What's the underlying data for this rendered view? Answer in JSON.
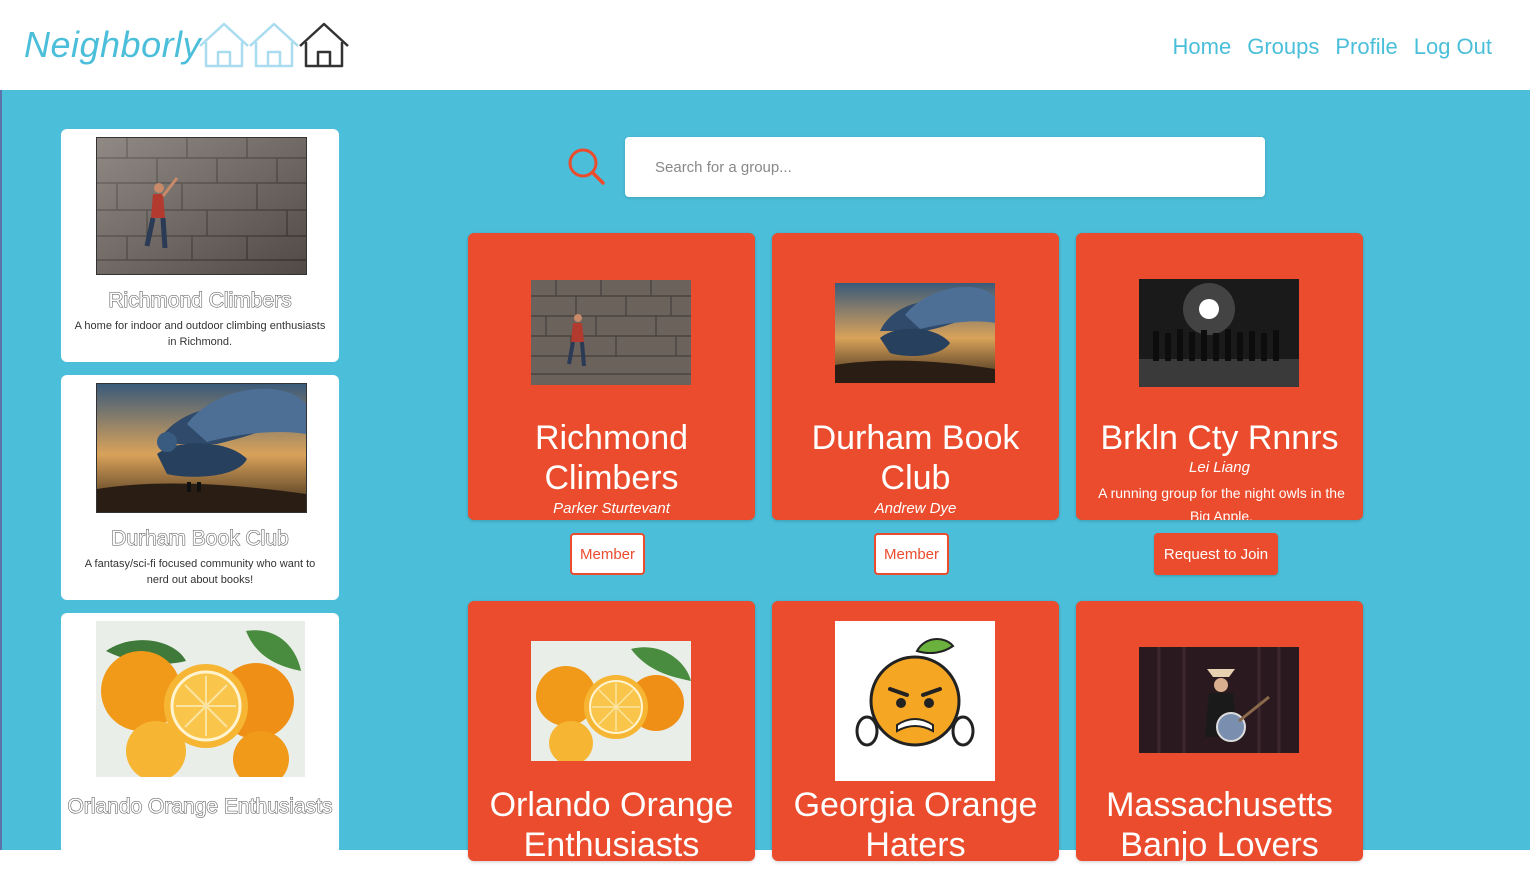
{
  "brand": {
    "name": "Neighborly"
  },
  "nav": {
    "items": [
      "Home",
      "Groups",
      "Profile",
      "Log Out"
    ]
  },
  "search": {
    "placeholder": "Search for a group..."
  },
  "sidebar": {
    "cards": [
      {
        "title": "Richmond Climbers",
        "description": "A home for indoor and outdoor climbing enthusiasts in Richmond."
      },
      {
        "title": "Durham Book Club",
        "description": "A fantasy/sci-fi focused community who want to nerd out about books!"
      },
      {
        "title": "Orlando Orange Enthusiasts",
        "description": ""
      }
    ]
  },
  "groups": [
    {
      "name": "Richmond Climbers",
      "owner": "Parker Sturtevant",
      "description": "",
      "button": "Member",
      "status": "member"
    },
    {
      "name": "Durham Book Club",
      "owner": "Andrew Dye",
      "description": "",
      "button": "Member",
      "status": "member"
    },
    {
      "name": "Brkln Cty Rnnrs",
      "owner": "Lei Liang",
      "description": "A running group for the night owls in the Big Apple.",
      "button": "Request to Join",
      "status": "not-member"
    },
    {
      "name": "Orlando Orange Enthusiasts",
      "owner": "",
      "description": "",
      "button": "",
      "status": ""
    },
    {
      "name": "Georgia Orange Haters",
      "owner": "",
      "description": "",
      "button": "",
      "status": ""
    },
    {
      "name": "Massachusetts Banjo Lovers",
      "owner": "",
      "description": "",
      "button": "",
      "status": ""
    }
  ],
  "colors": {
    "accent": "#ea4c2d",
    "background": "#4bbed9",
    "brand": "#4bbed9"
  },
  "icons": [
    "house-icon",
    "search-icon"
  ]
}
